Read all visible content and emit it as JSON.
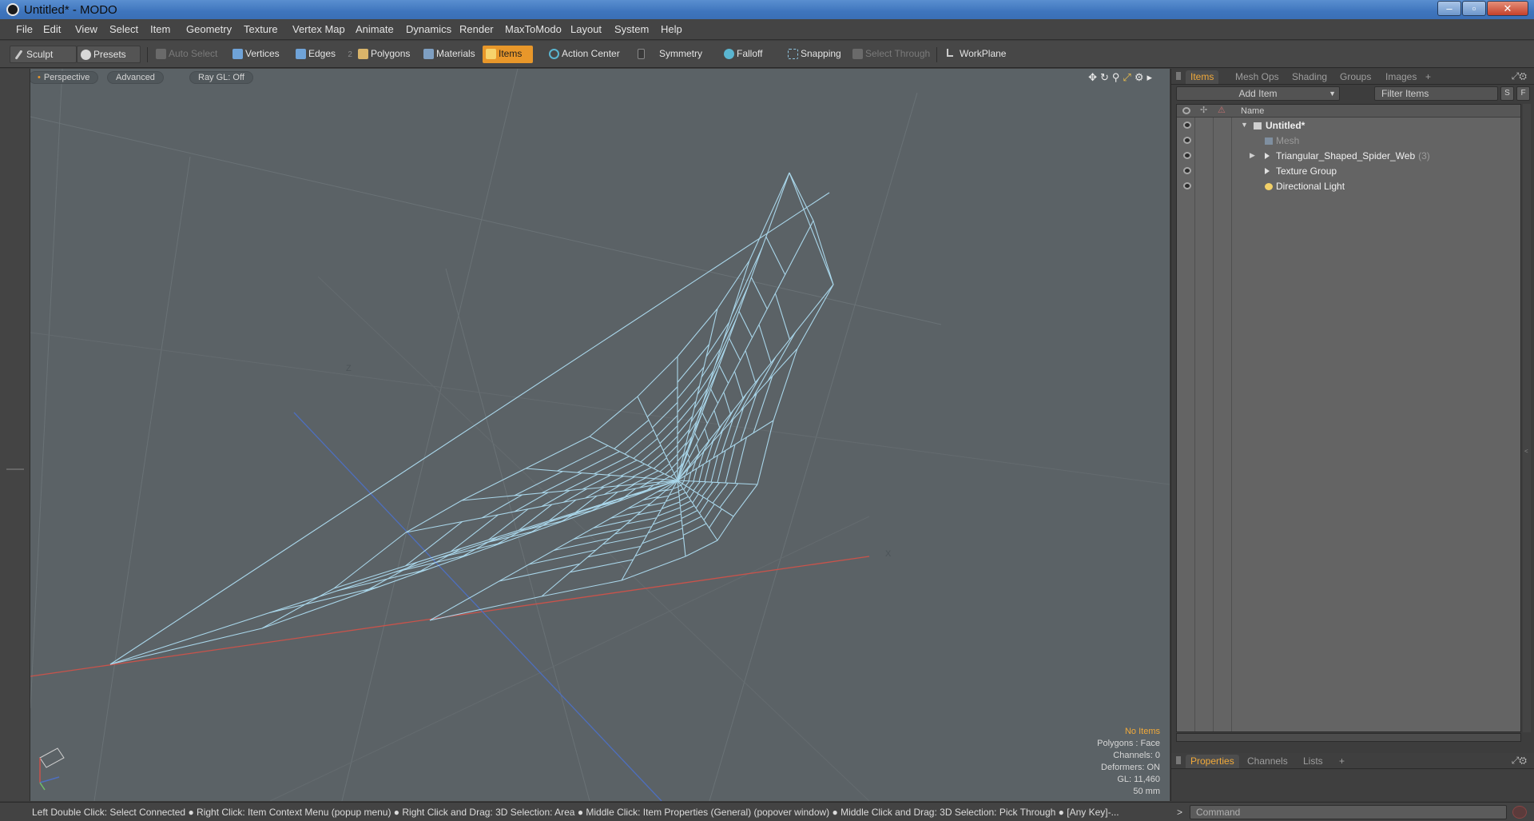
{
  "window": {
    "title": "Untitled* - MODO",
    "controls": {
      "minimize": "–",
      "maximize": "▫",
      "close": "✕"
    }
  },
  "menu": [
    "File",
    "Edit",
    "View",
    "Select",
    "Item",
    "Geometry",
    "Texture",
    "Vertex Map",
    "Animate",
    "Dynamics",
    "Render",
    "MaxToModo",
    "Layout",
    "System",
    "Help"
  ],
  "toolbar": {
    "sculpt": "Sculpt",
    "presets": "Presets",
    "auto_select": "Auto Select",
    "vertices": "Vertices",
    "edges": "Edges",
    "edges_count": "2",
    "polygons": "Polygons",
    "materials": "Materials",
    "items": "Items",
    "action_center": "Action Center",
    "symmetry": "Symmetry",
    "falloff": "Falloff",
    "snapping": "Snapping",
    "select_through": "Select Through",
    "workplane": "WorkPlane",
    "colors": {
      "active": "#e8972a",
      "vertex_icon": "#6fa3d8",
      "item_icon": "#f2c14a"
    }
  },
  "viewport": {
    "tabs": [
      "Perspective",
      "Advanced",
      "Ray GL: Off"
    ],
    "icons": [
      "move-view-icon",
      "rotate-view-icon",
      "zoom-view-icon",
      "maximize-view-icon",
      "settings-icon",
      "more-icon"
    ],
    "info": {
      "selection": "No Items",
      "polygons": "Polygons : Face",
      "channels": "Channels: 0",
      "deformers": "Deformers: ON",
      "gl": "GL: 11,460",
      "lens": "50 mm"
    },
    "colors": {
      "background": "#5b6266",
      "wire": "#a9d6ea",
      "x_axis": "#c9534b",
      "z_axis": "#4e6fbf"
    }
  },
  "items_panel": {
    "tabs": [
      "Items",
      "Mesh Ops",
      "Shading",
      "Groups",
      "Images",
      "+"
    ],
    "add_item": "Add Item",
    "filter_placeholder": "Filter Items",
    "btn_s": "S",
    "btn_f": "F",
    "col_name": "Name",
    "tree": [
      {
        "label": "Untitled*",
        "kind": "scene"
      },
      {
        "label": "Mesh",
        "kind": "mesh"
      },
      {
        "label": "Triangular_Shaped_Spider_Web",
        "count": "(3)",
        "kind": "group"
      },
      {
        "label": "Texture Group",
        "kind": "group"
      },
      {
        "label": "Directional Light",
        "kind": "light"
      }
    ]
  },
  "props_panel": {
    "tabs": [
      "Properties",
      "Channels",
      "Lists",
      "+"
    ]
  },
  "statusbar": {
    "hint": "Left Double Click: Select Connected ● Right Click: Item Context Menu (popup menu) ● Right Click and Drag: 3D Selection: Area ● Middle Click: Item Properties (General) (popover window) ● Middle Click and Drag: 3D Selection: Pick Through ● [Any Key]-...",
    "prompt": ">",
    "command_placeholder": "Command"
  }
}
